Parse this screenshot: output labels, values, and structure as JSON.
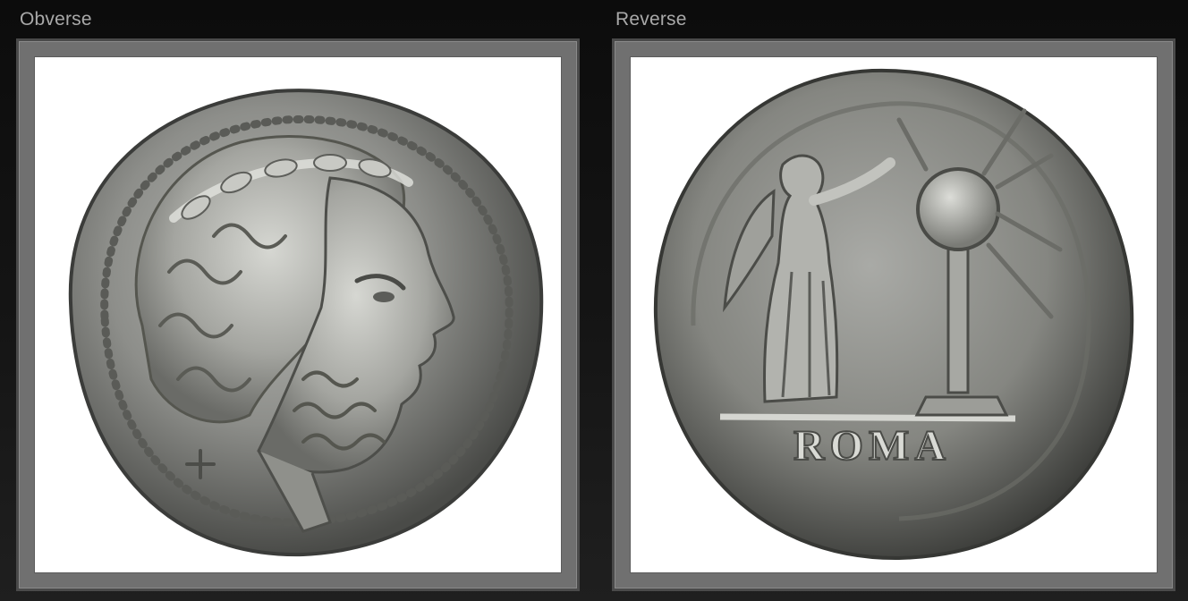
{
  "panels": [
    {
      "title": "Obverse"
    },
    {
      "title": "Reverse"
    }
  ],
  "coins": {
    "reverse_legend": "ROMA"
  },
  "colors": {
    "background": "#111111",
    "frame": "#707070",
    "title_text": "#a9a9a9",
    "silver_light": "#cfd0cc",
    "silver_dark": "#3b3c3a"
  }
}
